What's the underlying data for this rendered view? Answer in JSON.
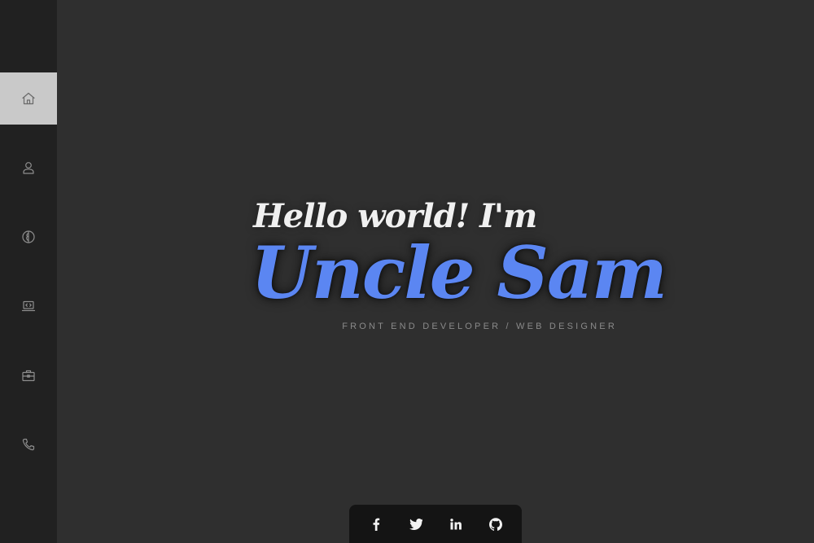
{
  "sidebar": {
    "items": [
      {
        "icon": "home-icon",
        "active": true
      },
      {
        "icon": "user-icon",
        "active": false
      },
      {
        "icon": "brain-icon",
        "active": false
      },
      {
        "icon": "laptop-code-icon",
        "active": false
      },
      {
        "icon": "briefcase-icon",
        "active": false
      },
      {
        "icon": "phone-icon",
        "active": false
      }
    ]
  },
  "hero": {
    "greeting": "Hello world! I'm",
    "name": "Uncle Sam",
    "subtitle": "FRONT END DEVELOPER / WEB DESIGNER"
  },
  "social": {
    "links": [
      {
        "icon": "facebook-icon"
      },
      {
        "icon": "twitter-icon"
      },
      {
        "icon": "linkedin-icon"
      },
      {
        "icon": "github-icon"
      }
    ]
  },
  "colors": {
    "accent": "#5b86f2",
    "background": "#2f2f2f",
    "sidebar": "#212121",
    "active_nav": "#c9c9c9"
  }
}
